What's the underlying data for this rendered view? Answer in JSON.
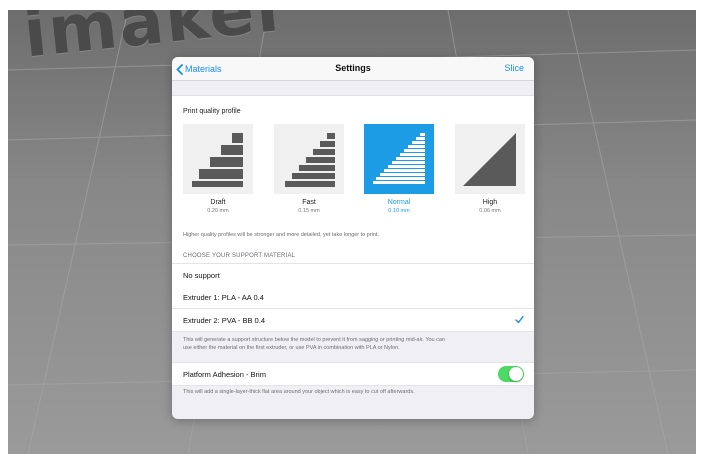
{
  "background": {
    "logo_text": "imaker",
    "colors": {
      "floor": "#888888",
      "logo": "#4a4a4a"
    }
  },
  "navbar": {
    "back_label": "Materials",
    "title": "Settings",
    "action_label": "Slice",
    "accent_color": "#1a8cf0"
  },
  "quality": {
    "heading": "Print quality profile",
    "profiles": [
      {
        "name": "Draft",
        "layer": "0.20 mm",
        "selected": false
      },
      {
        "name": "Fast",
        "layer": "0.15 mm",
        "selected": false
      },
      {
        "name": "Normal",
        "layer": "0.10 mm",
        "selected": true
      },
      {
        "name": "High",
        "layer": "0.06 mm",
        "selected": false
      }
    ],
    "selected_color": "#1d9ce6",
    "note": "Higher quality profiles will be stronger and more detailed, yet take longer to print."
  },
  "support": {
    "section_header": "CHOOSE YOUR SUPPORT MATERIAL",
    "options": [
      {
        "label": "No support",
        "checked": false
      },
      {
        "label": "Extruder 1: PLA - AA 0.4",
        "checked": false
      },
      {
        "label": "Extruder 2: PVA - BB 0.4",
        "checked": true
      }
    ],
    "note_line1": "This will generate a support structure below the model to prevent it from sagging or printing mid-air. You can",
    "note_line2": "use either the material on the first extruder, or use PVA in combination with PLA or Nylon."
  },
  "adhesion": {
    "label": "Platform Adhesion - Brim",
    "enabled": true,
    "toggle_color": "#4cd964",
    "note": "This will add a single-layer-thick flat area around your object which is easy to cut off afterwards."
  }
}
